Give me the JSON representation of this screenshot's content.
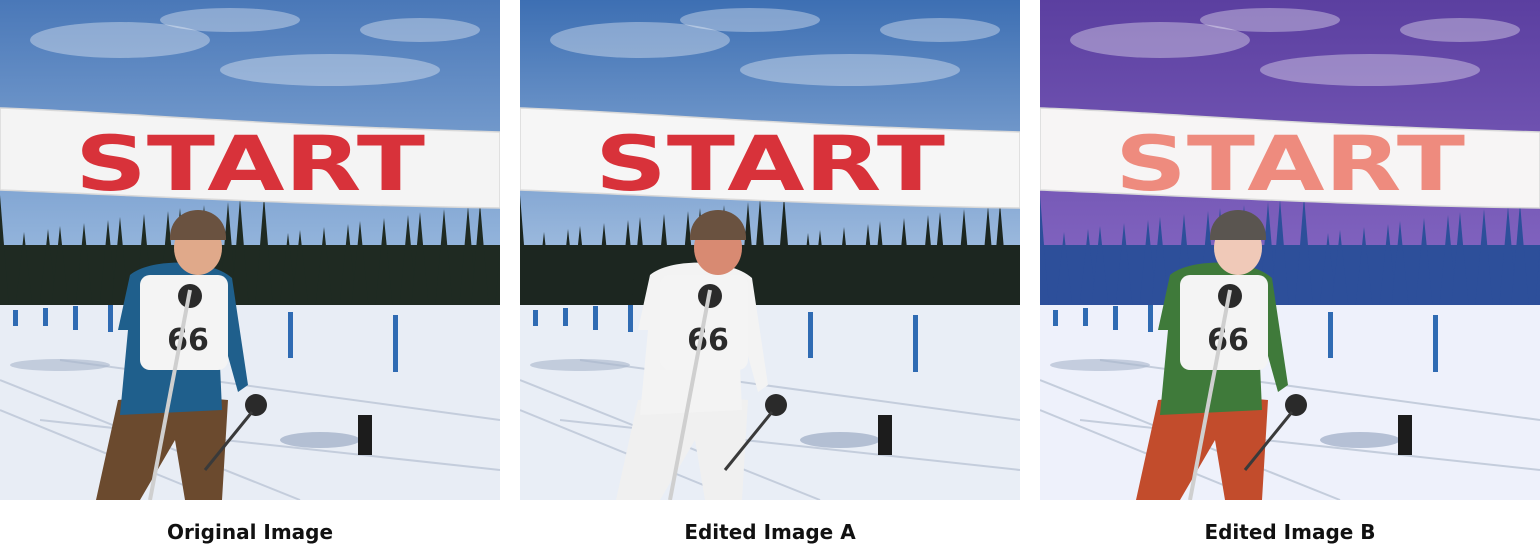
{
  "banner_text": "START",
  "bib_number": "66",
  "panels": [
    {
      "caption": "Original Image",
      "colors": {
        "sky_top": "#4a78b8",
        "sky_bottom": "#a9c6e6",
        "trees": "#1f2a22",
        "snow": "#e8edf5",
        "jacket": "#1f5f8c",
        "pants": "#6b4a2e",
        "hat": "#6a5240",
        "skin": "#e0a98a",
        "banner_text": "#d8323a",
        "banner": "#f4f4f4"
      }
    },
    {
      "caption": "Edited Image A",
      "colors": {
        "sky_top": "#3d6fb3",
        "sky_bottom": "#b7cfea",
        "trees": "#1c2620",
        "snow": "#e9eef6",
        "jacket": "#f3f3f3",
        "pants": "#f0f0f0",
        "hat": "#6a5240",
        "skin": "#d88a72",
        "banner_text": "#d8323a",
        "banner": "#f6f6f6"
      }
    },
    {
      "caption": "Edited Image B",
      "colors": {
        "sky_top": "#5b3fa0",
        "sky_bottom": "#8a6cc7",
        "trees": "#2d4f9a",
        "snow": "#eef1fb",
        "jacket": "#3f7a3a",
        "pants": "#c24c2c",
        "hat": "#5a5550",
        "skin": "#f0c9b8",
        "banner_text": "#ee8b7e",
        "banner": "#f7f5f5"
      }
    }
  ]
}
